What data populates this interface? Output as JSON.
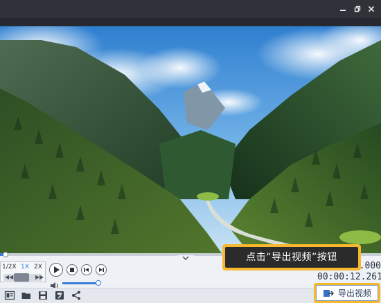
{
  "window": {
    "minimize_icon": "minimize-icon",
    "restore_icon": "restore-icon",
    "close_icon": "close-icon"
  },
  "video": {
    "scene": "mountain-valley-forest"
  },
  "playback": {
    "progress_fraction": 0.01,
    "speed_options": [
      "1/2X",
      "1X",
      "2X"
    ],
    "speed_selected": "1X",
    "volume_fraction": 0.95,
    "time_top": "0:00:00.000",
    "time_bottom": "00:00:12.261"
  },
  "toolbar": {
    "export_label": "导出视频",
    "icons": [
      "subtitle-icon",
      "folder-open-icon",
      "save-icon",
      "save-as-icon",
      "share-icon"
    ]
  },
  "callout": {
    "text": "点击“导出视频”按钮"
  },
  "colors": {
    "accent": "#3a7bd5",
    "highlight": "#f5b82e",
    "callout_bg": "#2b2b2b"
  }
}
